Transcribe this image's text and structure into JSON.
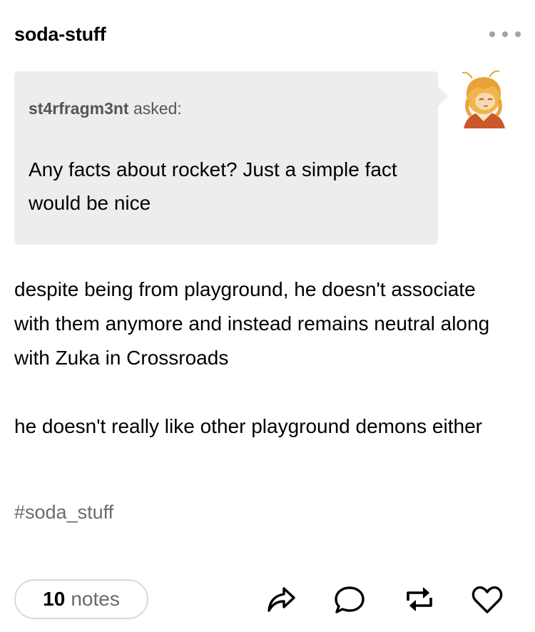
{
  "post": {
    "blog_name": "soda-stuff",
    "ask": {
      "asker": "st4rfragm3nt",
      "asked_label": "asked:",
      "question": "Any facts about rocket? Just a simple fact would be nice"
    },
    "answer": [
      "despite being from playground, he doesn't associate with them anymore and instead remains neutral along with Zuka in Crossroads",
      "he doesn't really like other playground demons either"
    ],
    "tag": "#soda_stuff"
  },
  "footer": {
    "notes_count": "10",
    "notes_label": "notes"
  },
  "icons": {
    "more": "more-dots-icon",
    "share": "share-icon",
    "reply": "reply-icon",
    "reblog": "reblog-icon",
    "like": "heart-icon"
  },
  "colors": {
    "ask_background": "#ededed",
    "muted_text": "#6b6b6b",
    "avatar_hair": "#e9a23a",
    "avatar_outfit": "#c9582a"
  }
}
